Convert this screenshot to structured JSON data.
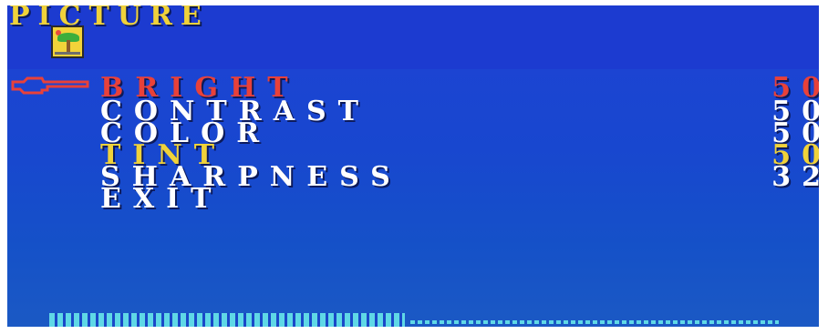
{
  "osd": {
    "title": "PICTURE",
    "category_icon": "palm-tree-picture-icon",
    "pointer_icon": "pointing-hand-icon",
    "colors": {
      "background": "#1c44d2",
      "selected": "#e8413a",
      "highlight": "#f0d23a",
      "normal": "#ffffff",
      "level_bar": "#5fd8e6"
    },
    "items": [
      {
        "label": "BRIGHT",
        "value": "50",
        "color": "#e8413a",
        "selected": true
      },
      {
        "label": "CONTRAST",
        "value": "50",
        "color": "#ffffff",
        "selected": false
      },
      {
        "label": "COLOR",
        "value": "50",
        "color": "#ffffff",
        "selected": false
      },
      {
        "label": "TINT",
        "value": "50",
        "color": "#f0d23a",
        "selected": false
      },
      {
        "label": "SHARPNESS",
        "value": "32",
        "color": "#ffffff",
        "selected": false
      },
      {
        "label": "EXIT",
        "value": "",
        "color": "#ffffff",
        "selected": false
      }
    ],
    "level_bar": {
      "value": 50,
      "max": 100
    }
  }
}
